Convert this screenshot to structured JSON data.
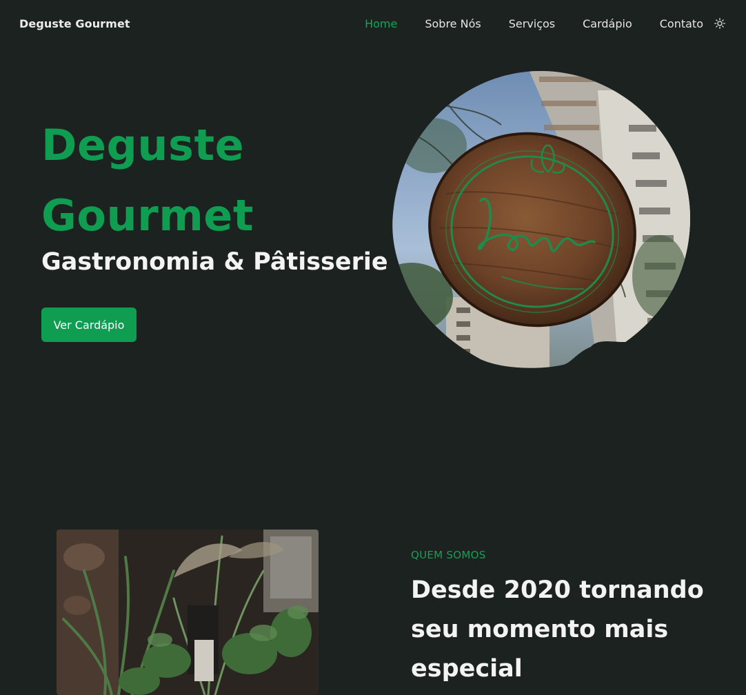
{
  "header": {
    "logo": "Deguste Gourmet",
    "nav": [
      {
        "label": "Home",
        "active": true
      },
      {
        "label": "Sobre Nós",
        "active": false
      },
      {
        "label": "Serviços",
        "active": false
      },
      {
        "label": "Cardápio",
        "active": false
      },
      {
        "label": "Contato",
        "active": false
      }
    ],
    "theme_toggle_icon": "sun-icon"
  },
  "hero": {
    "title_line1": "Deguste",
    "title_line2": "Gourmet",
    "subtitle": "Gastronomia & Pâtisserie",
    "button_label": "Ver Cardápio",
    "image_icon": "restaurant-sign-photo"
  },
  "about": {
    "kicker": "QUEM SOMOS",
    "title": "Desde 2020 tornando seu momento mais especial",
    "image_icon": "plants-decor-photo"
  },
  "colors": {
    "background": "#1c2220",
    "accent": "#0f9d52",
    "text": "#f3f3f3"
  }
}
